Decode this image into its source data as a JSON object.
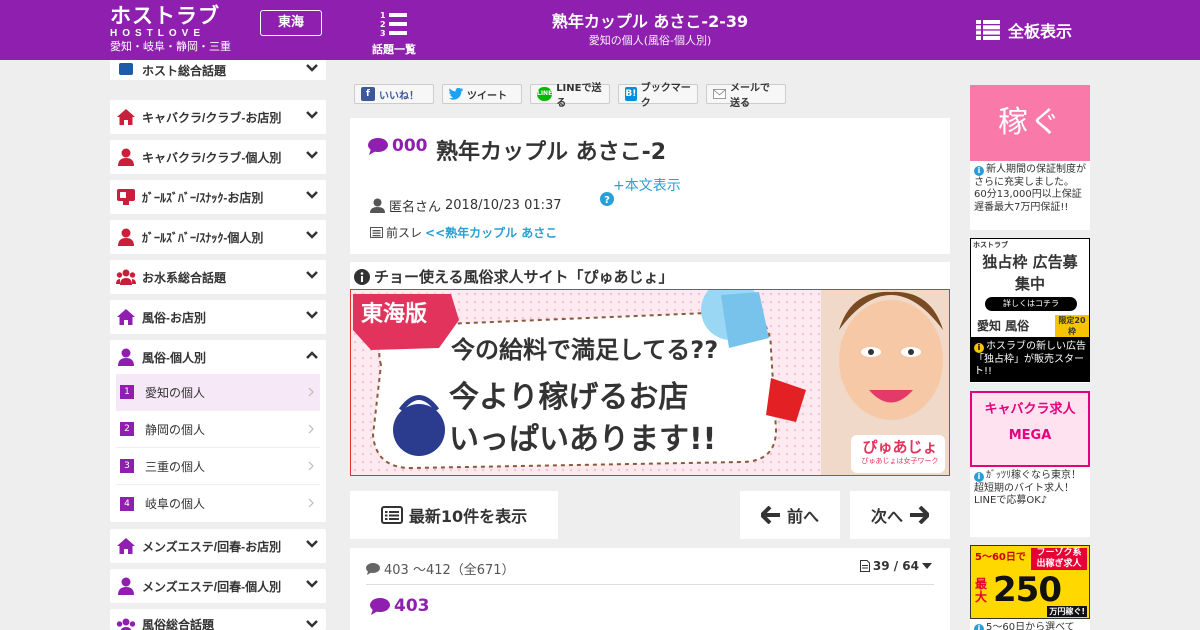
{
  "header": {
    "logo_main": "ホストラブ",
    "logo_sub": "HOSTLOVE",
    "logo_area": "愛知・岐阜・静岡・三重",
    "region": "東海",
    "topics_label": "話題一覧",
    "thread_title": "熟年カップル あさこ-2-39",
    "board_subtitle": "愛知の個人(風俗-個人別)",
    "all_boards": "全板表示"
  },
  "sidebar": {
    "partial_top": "ホスト総合話題",
    "categories": [
      {
        "label": "キャバクラ/クラブ-お店別",
        "icon": "house-icon"
      },
      {
        "label": "キャバクラ/クラブ-個人別",
        "icon": "person-icon"
      },
      {
        "label": "ｶﾞｰﾙｽﾞﾊﾞｰ/ｽﾅｯｸ-お店別",
        "icon": "glass-icon"
      },
      {
        "label": "ｶﾞｰﾙｽﾞﾊﾞｰ/ｽﾅｯｸ-個人別",
        "icon": "person-icon"
      },
      {
        "label": "お水系総合話題",
        "icon": "group-icon"
      },
      {
        "label": "風俗-お店別",
        "icon": "house-icon"
      }
    ],
    "expanded": {
      "label": "風俗-個人別",
      "items": [
        {
          "num": "1",
          "label": "愛知の個人"
        },
        {
          "num": "2",
          "label": "静岡の個人"
        },
        {
          "num": "3",
          "label": "三重の個人"
        },
        {
          "num": "4",
          "label": "岐阜の個人"
        }
      ]
    },
    "categories_bottom": [
      {
        "label": "メンズエステ/回春-お店別",
        "icon": "house-icon"
      },
      {
        "label": "メンズエステ/回春-個人別",
        "icon": "person-icon"
      },
      {
        "label": "風俗総合話題",
        "icon": "group-icon"
      }
    ]
  },
  "share": {
    "like": "いいね！",
    "tweet": "ツイート",
    "line": "LINEで送る",
    "bookmark": "ブックマーク",
    "mail": "メールで送る",
    "line_icon_text": "LINE",
    "bookmark_icon_text": "B!"
  },
  "post": {
    "number": "000",
    "title": "熟年カップル あさこ-2",
    "show_body": "+本文表示",
    "author": "匿名さん",
    "datetime": "2018/10/23 01:37",
    "prev_label": "前スレ",
    "prev_link": "<<熟年カップル あさこ"
  },
  "ad": {
    "title": "チョー使える風俗求人サイト「ぴゅあじょ」",
    "badge": "東海版",
    "line1": "今の給料で満足してる??",
    "line2": "今より稼げるお店",
    "line3": "いっぱいあります!!",
    "brand": "ぴゅあじょ",
    "brand_sub": "ぴゅあじょは女子ワーク"
  },
  "nav": {
    "latest": "最新10件を表示",
    "prev": "前へ",
    "next": "次へ"
  },
  "responses": {
    "range": "403 ～412（全671）",
    "page": "39 / 64",
    "first_num": "403"
  },
  "right_ads": [
    {
      "banner_text": "稼ぐ",
      "text": "新人期間の保証制度がさらに充実しました。60分13,000円以上保証　遅番最大7万円保証!!"
    },
    {
      "banner_text": "独占枠 広告募集中",
      "small": "詳しくはコチラ",
      "area": "愛知 風俗",
      "limit": "限定20枠",
      "text": "ホスラブの新しい広告「独占枠」が販売スタート!!",
      "brand": "ホストラブ"
    },
    {
      "banner_text": "キャバクラ求人 MEGA",
      "text": "ｶﾞｯﾂﾘ稼ぐなら東京！超短期のバイト求人！LINEで応募OK♪"
    },
    {
      "banner_text": "5〜60日で フーゾク系 出稼ぎ求人 最大250万円稼ぐ!",
      "head": "5〜60日で",
      "tag": "フーゾク系 出稼ぎ求人",
      "label_max": "最大",
      "amount": "250",
      "unit": "万円稼ぐ!",
      "text": "5〜60日から選べて"
    }
  ],
  "colors": {
    "brand": "#8f1fae",
    "link": "#2a9fd6",
    "accent_pink": "#ff5fa0"
  }
}
